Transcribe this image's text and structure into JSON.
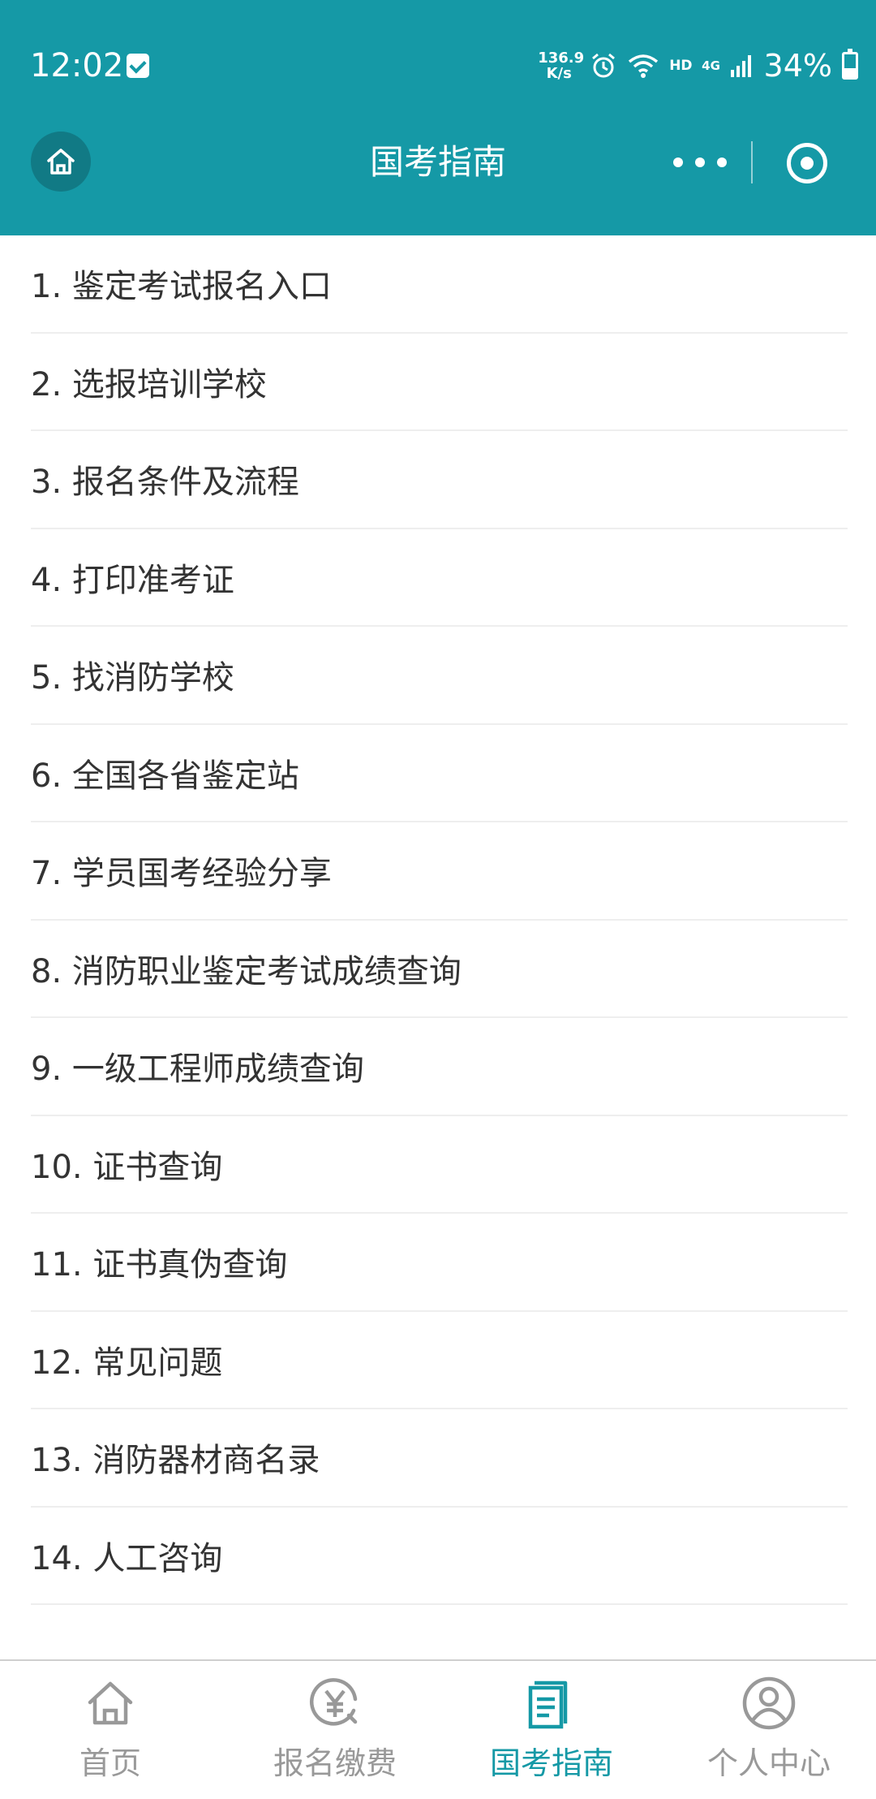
{
  "status_bar": {
    "time": "12:02",
    "net_speed_value": "136.9",
    "net_speed_unit": "K/s",
    "hd": "HD",
    "network": "4G",
    "battery": "34%"
  },
  "header": {
    "title": "国考指南"
  },
  "menu": [
    "1. 鉴定考试报名入口",
    "2. 选报培训学校",
    "3. 报名条件及流程",
    "4. 打印准考证",
    "5. 找消防学校",
    "6. 全国各省鉴定站",
    "7. 学员国考经验分享",
    "8. 消防职业鉴定考试成绩查询",
    "9. 一级工程师成绩查询",
    "10. 证书查询",
    "11. 证书真伪查询",
    "12. 常见问题",
    "13. 消防器材商名录",
    "14. 人工咨询"
  ],
  "tabbar": {
    "tabs": [
      {
        "label": "首页",
        "icon": "home-icon",
        "active": false
      },
      {
        "label": "报名缴费",
        "icon": "yen-refresh-icon",
        "active": false
      },
      {
        "label": "国考指南",
        "icon": "document-icon",
        "active": true
      },
      {
        "label": "个人中心",
        "icon": "user-icon",
        "active": false
      }
    ]
  },
  "colors": {
    "brand": "#1599a6",
    "inactive": "#999999",
    "text": "#333333",
    "divider": "#eeeeee"
  }
}
